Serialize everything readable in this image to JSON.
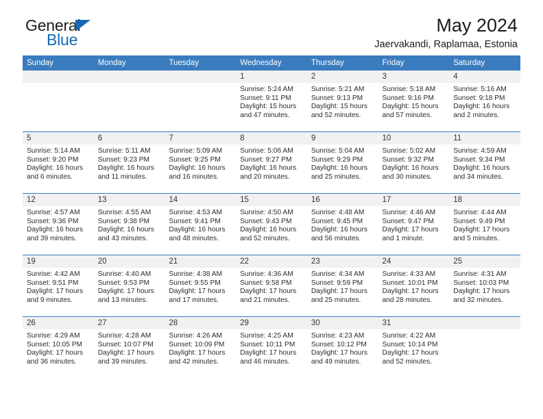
{
  "brand": {
    "name_part1": "General",
    "name_part2": "Blue",
    "triangle_color": "#1569b4"
  },
  "header": {
    "title": "May 2024",
    "subtitle": "Jaervakandi, Raplamaa, Estonia"
  },
  "colors": {
    "header_blue": "#3b7cbf",
    "daynum_gray": "#f1f1f1",
    "text": "#2b2b2b"
  },
  "calendar": {
    "weekday_headers": [
      "Sunday",
      "Monday",
      "Tuesday",
      "Wednesday",
      "Thursday",
      "Friday",
      "Saturday"
    ],
    "weeks": [
      [
        {
          "day": "",
          "empty": true
        },
        {
          "day": "",
          "empty": true
        },
        {
          "day": "",
          "empty": true
        },
        {
          "day": "1",
          "sunrise": "Sunrise: 5:24 AM",
          "sunset": "Sunset: 9:11 PM",
          "daylight": "Daylight: 15 hours and 47 minutes."
        },
        {
          "day": "2",
          "sunrise": "Sunrise: 5:21 AM",
          "sunset": "Sunset: 9:13 PM",
          "daylight": "Daylight: 15 hours and 52 minutes."
        },
        {
          "day": "3",
          "sunrise": "Sunrise: 5:18 AM",
          "sunset": "Sunset: 9:16 PM",
          "daylight": "Daylight: 15 hours and 57 minutes."
        },
        {
          "day": "4",
          "sunrise": "Sunrise: 5:16 AM",
          "sunset": "Sunset: 9:18 PM",
          "daylight": "Daylight: 16 hours and 2 minutes."
        }
      ],
      [
        {
          "day": "5",
          "sunrise": "Sunrise: 5:14 AM",
          "sunset": "Sunset: 9:20 PM",
          "daylight": "Daylight: 16 hours and 6 minutes."
        },
        {
          "day": "6",
          "sunrise": "Sunrise: 5:11 AM",
          "sunset": "Sunset: 9:23 PM",
          "daylight": "Daylight: 16 hours and 11 minutes."
        },
        {
          "day": "7",
          "sunrise": "Sunrise: 5:09 AM",
          "sunset": "Sunset: 9:25 PM",
          "daylight": "Daylight: 16 hours and 16 minutes."
        },
        {
          "day": "8",
          "sunrise": "Sunrise: 5:06 AM",
          "sunset": "Sunset: 9:27 PM",
          "daylight": "Daylight: 16 hours and 20 minutes."
        },
        {
          "day": "9",
          "sunrise": "Sunrise: 5:04 AM",
          "sunset": "Sunset: 9:29 PM",
          "daylight": "Daylight: 16 hours and 25 minutes."
        },
        {
          "day": "10",
          "sunrise": "Sunrise: 5:02 AM",
          "sunset": "Sunset: 9:32 PM",
          "daylight": "Daylight: 16 hours and 30 minutes."
        },
        {
          "day": "11",
          "sunrise": "Sunrise: 4:59 AM",
          "sunset": "Sunset: 9:34 PM",
          "daylight": "Daylight: 16 hours and 34 minutes."
        }
      ],
      [
        {
          "day": "12",
          "sunrise": "Sunrise: 4:57 AM",
          "sunset": "Sunset: 9:36 PM",
          "daylight": "Daylight: 16 hours and 39 minutes."
        },
        {
          "day": "13",
          "sunrise": "Sunrise: 4:55 AM",
          "sunset": "Sunset: 9:38 PM",
          "daylight": "Daylight: 16 hours and 43 minutes."
        },
        {
          "day": "14",
          "sunrise": "Sunrise: 4:53 AM",
          "sunset": "Sunset: 9:41 PM",
          "daylight": "Daylight: 16 hours and 48 minutes."
        },
        {
          "day": "15",
          "sunrise": "Sunrise: 4:50 AM",
          "sunset": "Sunset: 9:43 PM",
          "daylight": "Daylight: 16 hours and 52 minutes."
        },
        {
          "day": "16",
          "sunrise": "Sunrise: 4:48 AM",
          "sunset": "Sunset: 9:45 PM",
          "daylight": "Daylight: 16 hours and 56 minutes."
        },
        {
          "day": "17",
          "sunrise": "Sunrise: 4:46 AM",
          "sunset": "Sunset: 9:47 PM",
          "daylight": "Daylight: 17 hours and 1 minute."
        },
        {
          "day": "18",
          "sunrise": "Sunrise: 4:44 AM",
          "sunset": "Sunset: 9:49 PM",
          "daylight": "Daylight: 17 hours and 5 minutes."
        }
      ],
      [
        {
          "day": "19",
          "sunrise": "Sunrise: 4:42 AM",
          "sunset": "Sunset: 9:51 PM",
          "daylight": "Daylight: 17 hours and 9 minutes."
        },
        {
          "day": "20",
          "sunrise": "Sunrise: 4:40 AM",
          "sunset": "Sunset: 9:53 PM",
          "daylight": "Daylight: 17 hours and 13 minutes."
        },
        {
          "day": "21",
          "sunrise": "Sunrise: 4:38 AM",
          "sunset": "Sunset: 9:55 PM",
          "daylight": "Daylight: 17 hours and 17 minutes."
        },
        {
          "day": "22",
          "sunrise": "Sunrise: 4:36 AM",
          "sunset": "Sunset: 9:58 PM",
          "daylight": "Daylight: 17 hours and 21 minutes."
        },
        {
          "day": "23",
          "sunrise": "Sunrise: 4:34 AM",
          "sunset": "Sunset: 9:59 PM",
          "daylight": "Daylight: 17 hours and 25 minutes."
        },
        {
          "day": "24",
          "sunrise": "Sunrise: 4:33 AM",
          "sunset": "Sunset: 10:01 PM",
          "daylight": "Daylight: 17 hours and 28 minutes."
        },
        {
          "day": "25",
          "sunrise": "Sunrise: 4:31 AM",
          "sunset": "Sunset: 10:03 PM",
          "daylight": "Daylight: 17 hours and 32 minutes."
        }
      ],
      [
        {
          "day": "26",
          "sunrise": "Sunrise: 4:29 AM",
          "sunset": "Sunset: 10:05 PM",
          "daylight": "Daylight: 17 hours and 36 minutes."
        },
        {
          "day": "27",
          "sunrise": "Sunrise: 4:28 AM",
          "sunset": "Sunset: 10:07 PM",
          "daylight": "Daylight: 17 hours and 39 minutes."
        },
        {
          "day": "28",
          "sunrise": "Sunrise: 4:26 AM",
          "sunset": "Sunset: 10:09 PM",
          "daylight": "Daylight: 17 hours and 42 minutes."
        },
        {
          "day": "29",
          "sunrise": "Sunrise: 4:25 AM",
          "sunset": "Sunset: 10:11 PM",
          "daylight": "Daylight: 17 hours and 46 minutes."
        },
        {
          "day": "30",
          "sunrise": "Sunrise: 4:23 AM",
          "sunset": "Sunset: 10:12 PM",
          "daylight": "Daylight: 17 hours and 49 minutes."
        },
        {
          "day": "31",
          "sunrise": "Sunrise: 4:22 AM",
          "sunset": "Sunset: 10:14 PM",
          "daylight": "Daylight: 17 hours and 52 minutes."
        },
        {
          "day": "",
          "empty": true
        }
      ]
    ]
  }
}
